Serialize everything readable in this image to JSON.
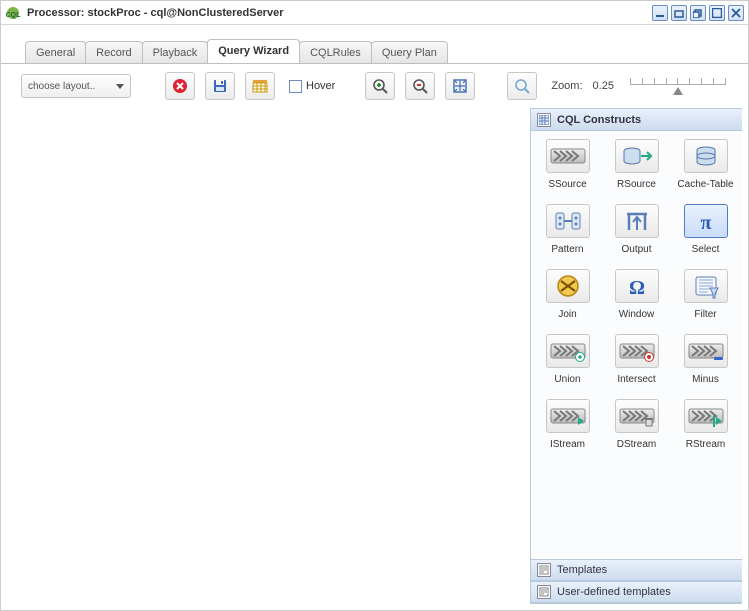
{
  "window": {
    "title": "Processor: stockProc - cql@NonClusteredServer"
  },
  "tabs": {
    "items": [
      {
        "label": "General"
      },
      {
        "label": "Record"
      },
      {
        "label": "Playback"
      },
      {
        "label": "Query Wizard",
        "active": true
      },
      {
        "label": "CQLRules"
      },
      {
        "label": "Query Plan"
      }
    ]
  },
  "toolbar": {
    "layout_placeholder": "choose layout..",
    "hover_label": "Hover",
    "zoom_label": "Zoom:",
    "zoom_value": "0.25"
  },
  "palette": {
    "title": "CQL Constructs",
    "items": [
      {
        "label": "SSource",
        "icon": "chevrons"
      },
      {
        "label": "RSource",
        "icon": "db-arrow"
      },
      {
        "label": "Cache-Table",
        "icon": "db-cache"
      },
      {
        "label": "Pattern",
        "icon": "pattern"
      },
      {
        "label": "Output",
        "icon": "output"
      },
      {
        "label": "Select",
        "icon": "pi",
        "selected": true
      },
      {
        "label": "Join",
        "icon": "join"
      },
      {
        "label": "Window",
        "icon": "omega"
      },
      {
        "label": "Filter",
        "icon": "filter"
      },
      {
        "label": "Union",
        "icon": "chev-plus"
      },
      {
        "label": "Intersect",
        "icon": "chev-inter"
      },
      {
        "label": "Minus",
        "icon": "chev-minus"
      },
      {
        "label": "IStream",
        "icon": "chev-i"
      },
      {
        "label": "DStream",
        "icon": "chev-d"
      },
      {
        "label": "RStream",
        "icon": "chev-r"
      }
    ],
    "sections": [
      {
        "label": "Templates"
      },
      {
        "label": "User-defined templates"
      }
    ]
  }
}
